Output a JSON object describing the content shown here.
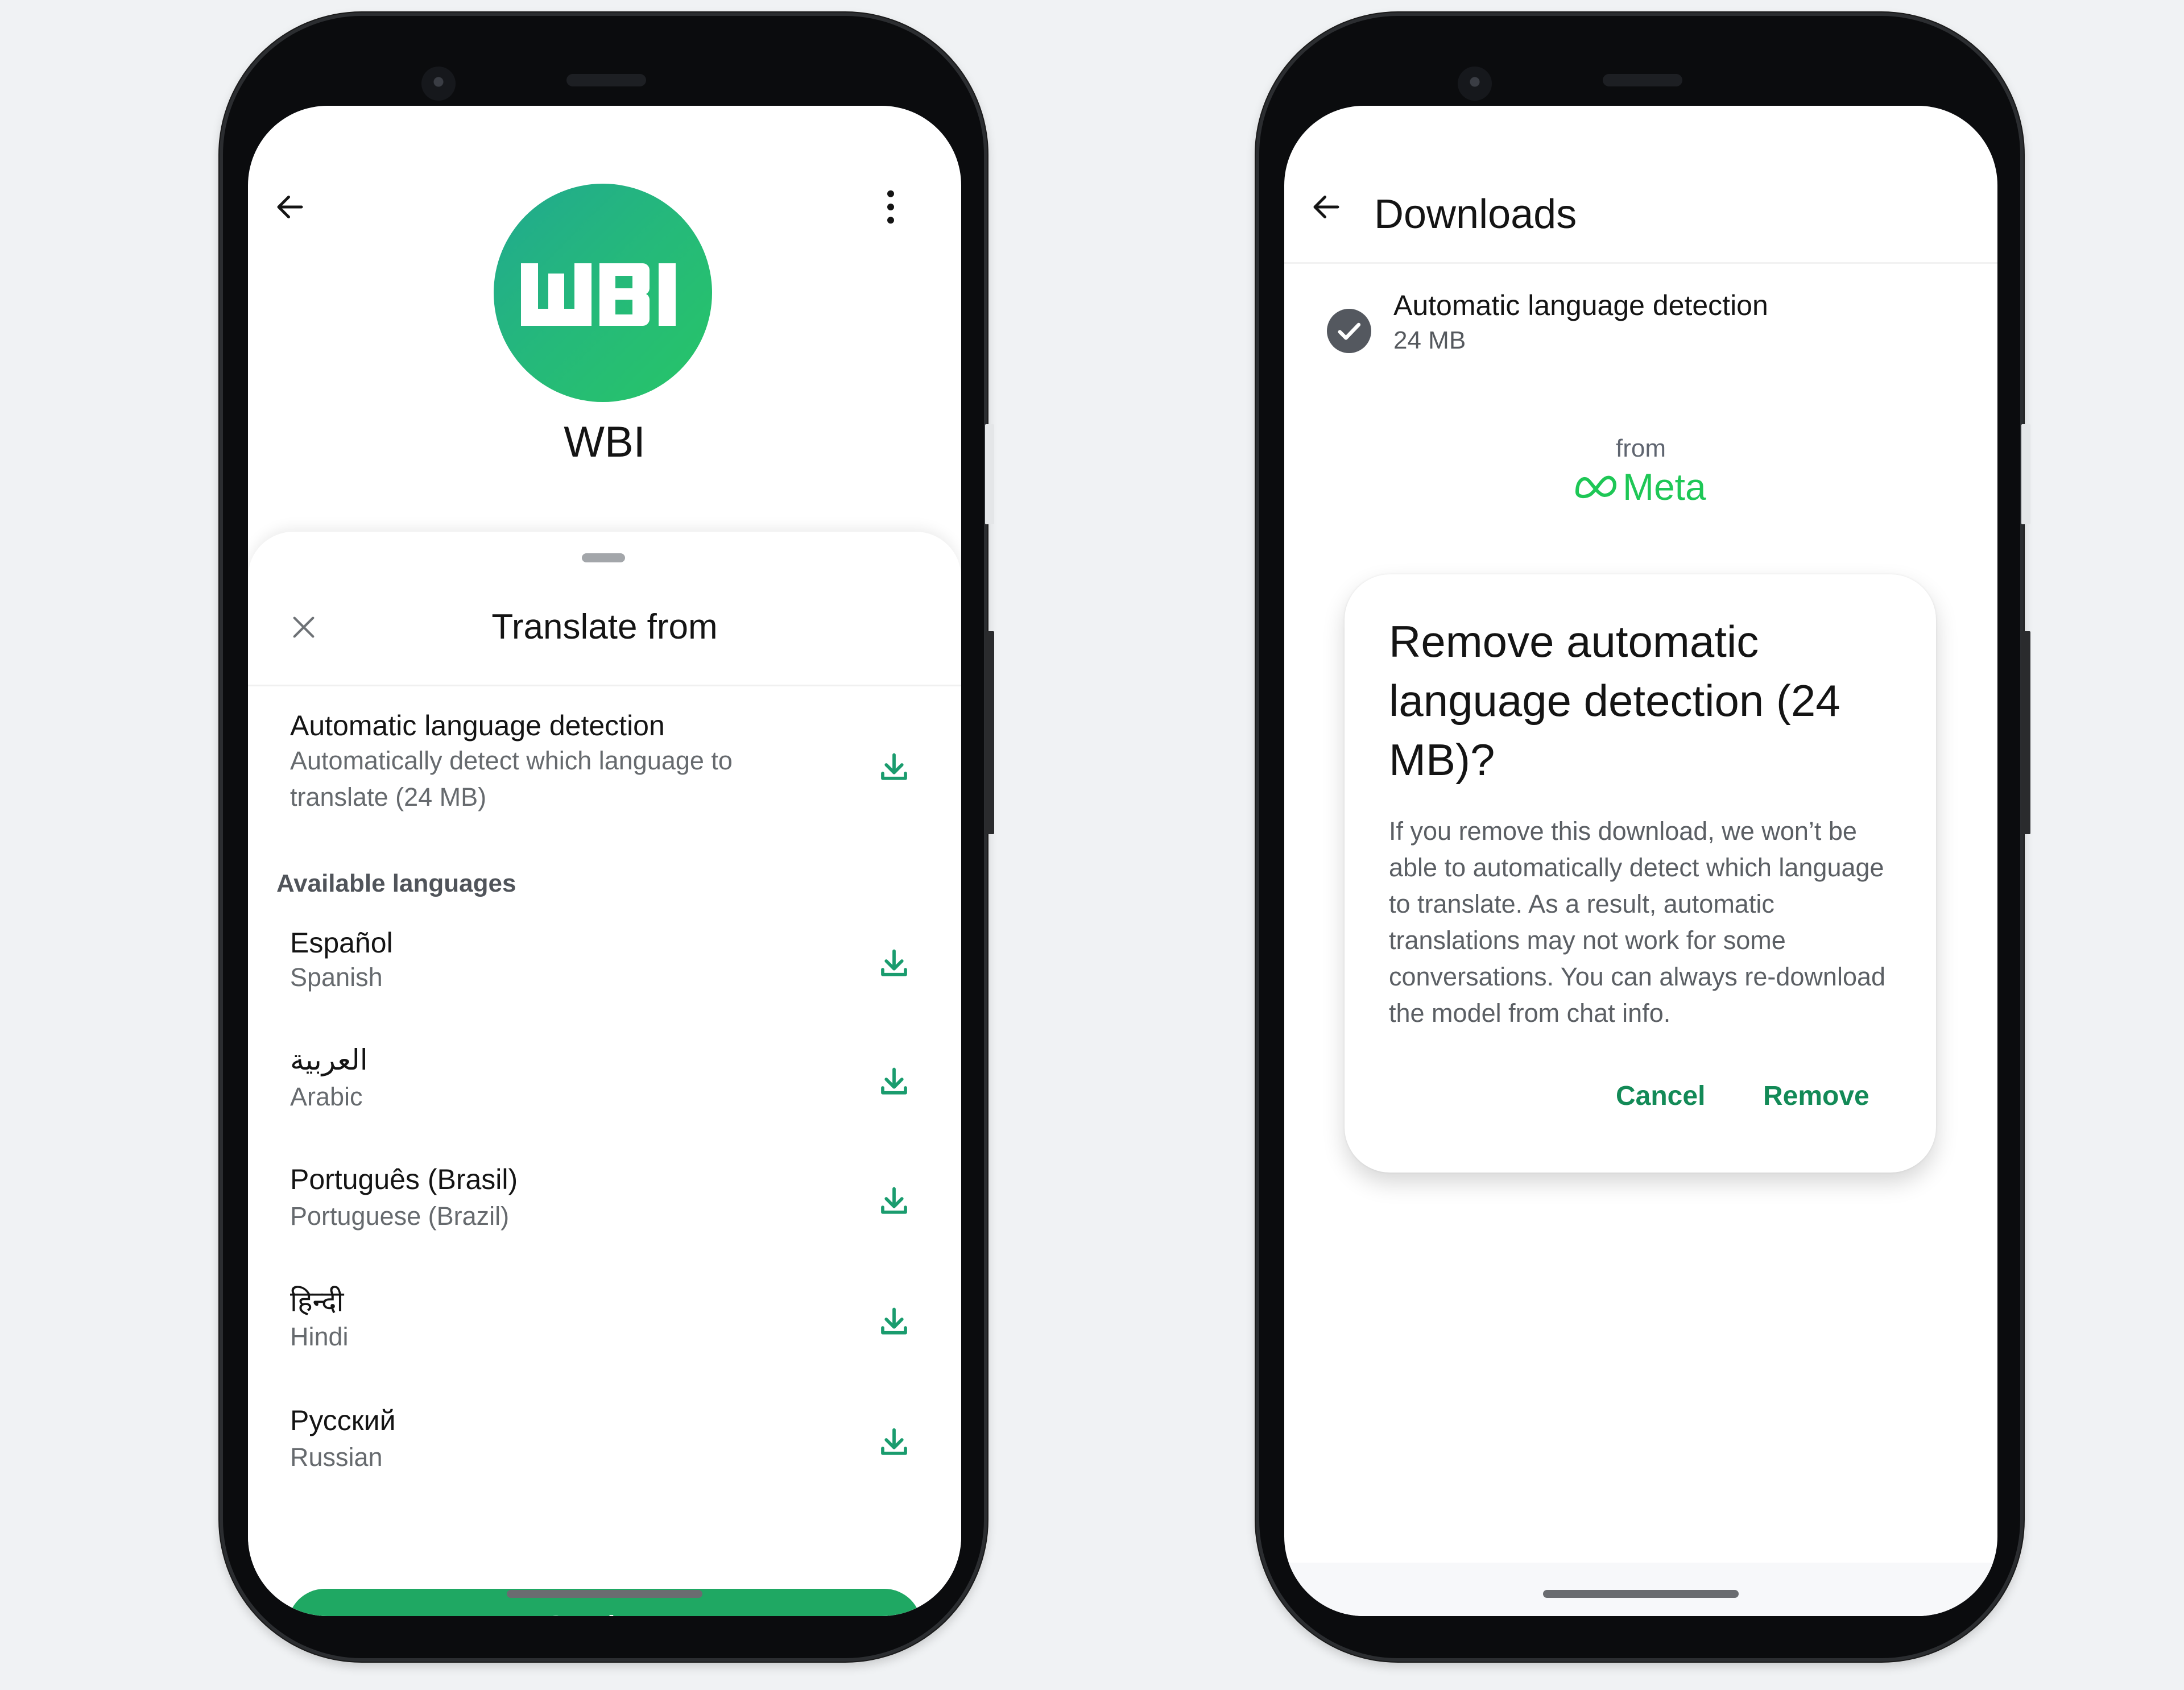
{
  "left_phone": {
    "header": {
      "back_icon": "arrow-left-icon",
      "menu_icon": "more-vertical-icon"
    },
    "profile": {
      "avatar_text": "WBI",
      "name": "WBI"
    },
    "sheet": {
      "close_icon": "close-icon",
      "title": "Translate from",
      "auto_detect": {
        "title": "Automatic language detection",
        "subtitle_line1": "Automatically detect which language to",
        "subtitle_line2": "translate (24 MB)",
        "icon": "download-icon"
      },
      "section_label": "Available languages",
      "languages": [
        {
          "native": "Español",
          "english": "Spanish",
          "icon": "download-icon"
        },
        {
          "native": "العربية",
          "english": "Arabic",
          "icon": "download-icon"
        },
        {
          "native": "Português (Brasil)",
          "english": "Portuguese (Brazil)",
          "icon": "download-icon"
        },
        {
          "native": "हिन्दी",
          "english": "Hindi",
          "icon": "download-icon"
        },
        {
          "native": "Русский",
          "english": "Russian",
          "icon": "download-icon"
        }
      ],
      "continue_label": "Continue"
    }
  },
  "right_phone": {
    "header": {
      "back_icon": "arrow-left-icon",
      "title": "Downloads"
    },
    "download_item": {
      "status_icon": "check-circle-icon",
      "title": "Automatic language detection",
      "size": "24 MB"
    },
    "branding": {
      "from_label": "from",
      "brand_name": "Meta",
      "brand_icon": "meta-infinity-logo"
    },
    "dialog": {
      "title": "Remove automatic language detection (24 MB)?",
      "body": "If you remove this download, we won’t be able to automatically detect which language to translate. As a result, automatic translations may not work for some conversations. You can always re-download the model from chat info.",
      "cancel_label": "Cancel",
      "remove_label": "Remove"
    }
  },
  "colors": {
    "accent_green": "#1fa863",
    "icon_green": "#1a9c6e",
    "dialog_button_green": "#138a57",
    "meta_green": "#1ec756",
    "check_grey": "#54585f"
  }
}
